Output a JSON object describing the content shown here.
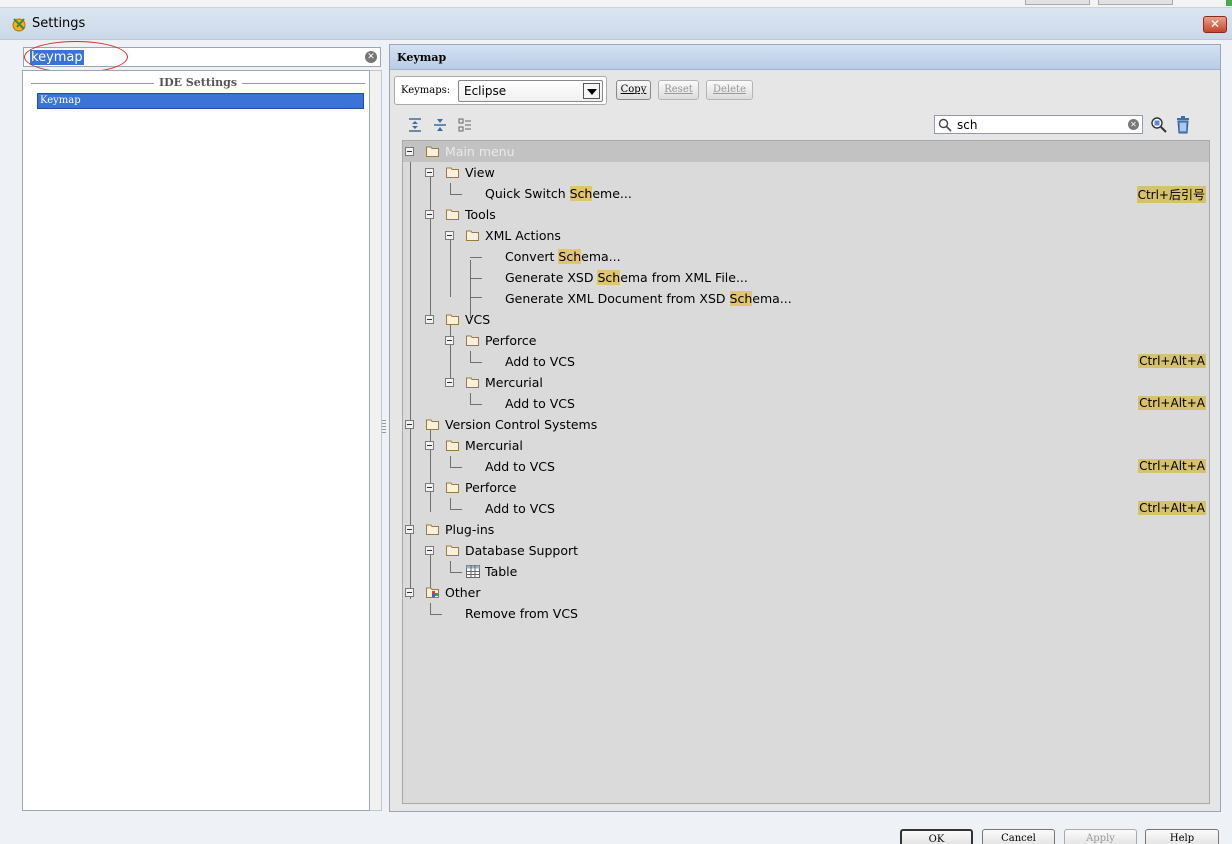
{
  "window": {
    "title": "Settings",
    "close_label": "✕"
  },
  "left": {
    "search_value": "keymap",
    "section_header": "IDE Settings",
    "items": [
      {
        "label": "Keymap",
        "selected": true
      }
    ]
  },
  "right": {
    "header": "Keymap",
    "keymaps_label": "Keymaps:",
    "keymap_value": "Eclipse",
    "buttons": {
      "copy": "Copy",
      "reset": "Reset",
      "delete": "Delete"
    },
    "tree_search_value": "sch",
    "tree": {
      "main_menu": "Main menu",
      "view": "View",
      "quick_switch": {
        "pre": "Quick Switch ",
        "hl": "Sch",
        "post": "eme...",
        "shortcut": "Ctrl+后引号"
      },
      "tools": "Tools",
      "xml_actions": "XML Actions",
      "convert_schema": {
        "pre": "Convert ",
        "hl": "Sch",
        "post": "ema..."
      },
      "gen_xsd": {
        "pre": "Generate XSD ",
        "hl": "Sch",
        "post": "ema from XML File..."
      },
      "gen_xml": {
        "pre": "Generate XML Document from XSD ",
        "hl": "Sch",
        "post": "ema..."
      },
      "vcs": "VCS",
      "perforce1": "Perforce",
      "add_vcs_1": {
        "label": "Add to VCS",
        "shortcut": "Ctrl+Alt+A"
      },
      "mercurial1": "Mercurial",
      "add_vcs_2": {
        "label": "Add to VCS",
        "shortcut": "Ctrl+Alt+A"
      },
      "version_control": "Version Control Systems",
      "mercurial2": "Mercurial",
      "add_vcs_3": {
        "label": "Add to VCS",
        "shortcut": "Ctrl+Alt+A"
      },
      "perforce2": "Perforce",
      "add_vcs_4": {
        "label": "Add to VCS",
        "shortcut": "Ctrl+Alt+A"
      },
      "plugins": "Plug-ins",
      "db_support": "Database Support",
      "table": "Table",
      "other": "Other",
      "remove_vcs": "Remove from VCS"
    }
  },
  "footer": {
    "ok": "OK",
    "cancel": "Cancel",
    "apply": "Apply",
    "help": "Help"
  },
  "colors": {
    "highlight": "#e0c56b",
    "selection": "#3b74d6",
    "folder": "#c8a15a"
  }
}
